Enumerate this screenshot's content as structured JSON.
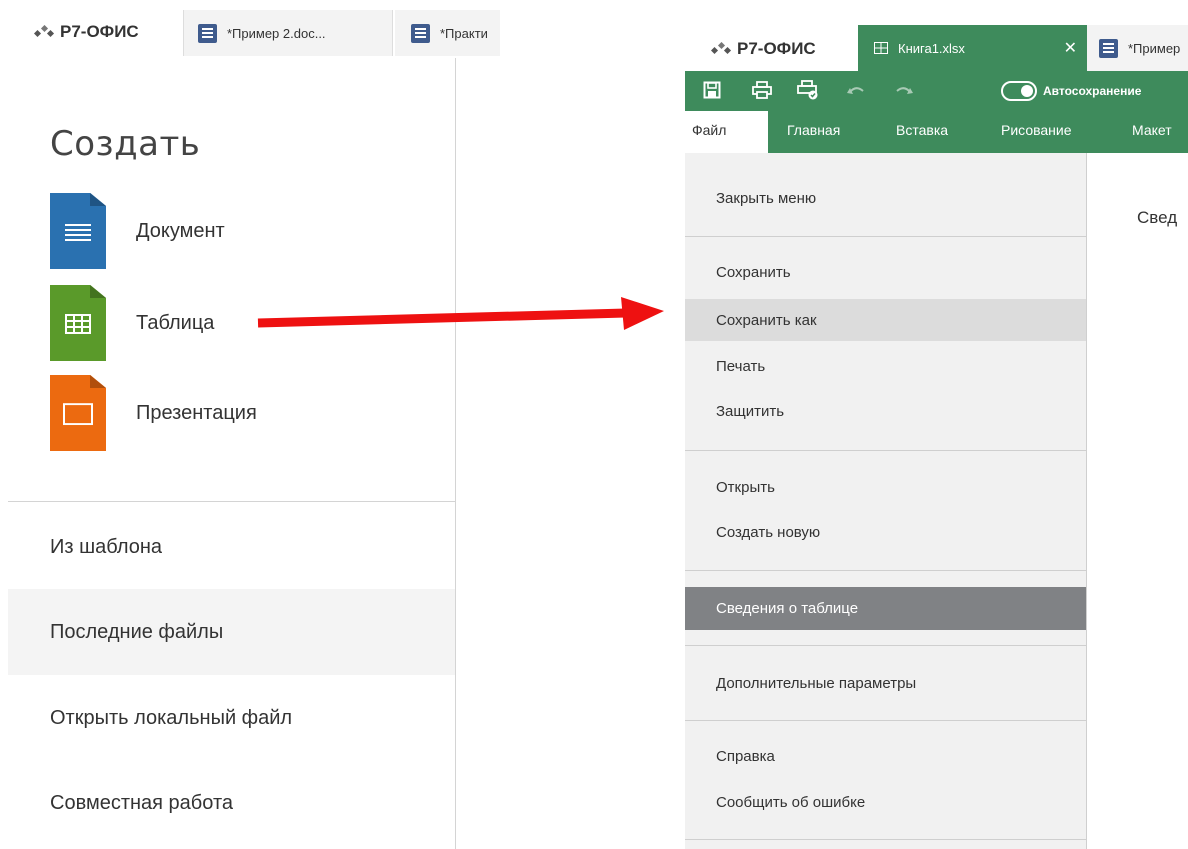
{
  "left": {
    "brand": "Р7-ОФИС",
    "tabs": [
      {
        "label": "*Пример 2.doc..."
      },
      {
        "label": "*Практи"
      }
    ],
    "create_title": "Создать",
    "create_items": [
      {
        "label": "Документ",
        "icon": "document-icon",
        "color": "#2a71b0"
      },
      {
        "label": "Таблица",
        "icon": "spreadsheet-icon",
        "color": "#5a9a2a"
      },
      {
        "label": "Презентация",
        "icon": "presentation-icon",
        "color": "#ec6a10"
      }
    ],
    "menu": [
      {
        "label": "Из шаблона"
      },
      {
        "label": "Последние файлы"
      },
      {
        "label": "Открыть локальный файл"
      },
      {
        "label": "Совместная работа"
      }
    ]
  },
  "arrow": {
    "color": "#ee1111"
  },
  "right": {
    "brand": "Р7-ОФИС",
    "tabs": [
      {
        "label": "Книга1.xlsx",
        "icon": "spreadsheet-icon",
        "active": true
      },
      {
        "label": "*Пример",
        "icon": "document-icon"
      }
    ],
    "toolbar": {
      "icons": [
        "save-icon",
        "print-icon",
        "quick-print-icon",
        "undo-icon",
        "redo-icon"
      ],
      "autosave_label": "Автосохранение"
    },
    "ribbon_tabs": [
      {
        "label": "Файл"
      },
      {
        "label": "Главная"
      },
      {
        "label": "Вставка"
      },
      {
        "label": "Рисование"
      },
      {
        "label": "Макет"
      }
    ],
    "file_menu": {
      "close": "Закрыть меню",
      "save": "Сохранить",
      "save_as": "Сохранить как",
      "print": "Печать",
      "protect": "Защитить",
      "open": "Открыть",
      "create_new": "Создать новую",
      "info": "Сведения о таблице",
      "advanced": "Дополнительные параметры",
      "help": "Справка",
      "report": "Сообщить об ошибке"
    },
    "info_heading": "Свед",
    "accent": "#3e8b5c"
  }
}
